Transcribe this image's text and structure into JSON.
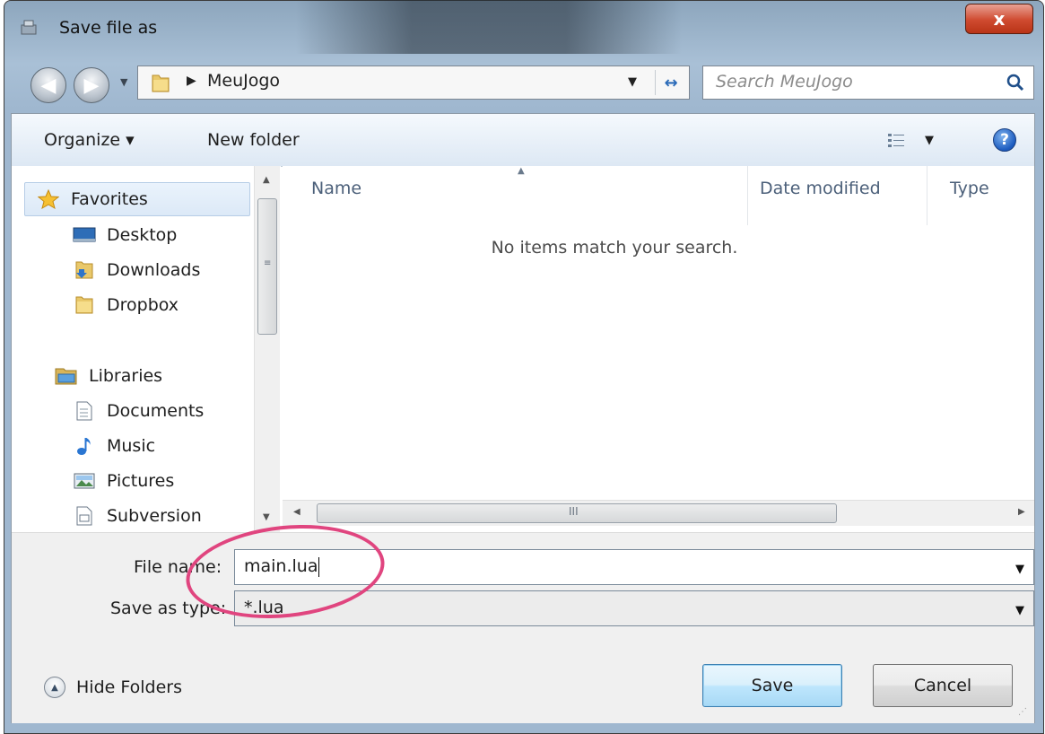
{
  "window": {
    "title": "Save file as",
    "close_label": "x"
  },
  "nav": {
    "back_icon": "back-arrow-icon",
    "forward_icon": "forward-arrow-icon",
    "breadcrumb": "MeuJogo",
    "search_placeholder": "Search MeuJogo"
  },
  "toolbar": {
    "organize": "Organize ▾",
    "new_folder": "New folder",
    "help": "?"
  },
  "sidebar": {
    "favorites_label": "Favorites",
    "favorites": [
      {
        "label": "Desktop",
        "icon": "desktop-icon"
      },
      {
        "label": "Downloads",
        "icon": "downloads-folder-icon"
      },
      {
        "label": "Dropbox",
        "icon": "folder-icon"
      }
    ],
    "libraries_label": "Libraries",
    "libraries": [
      {
        "label": "Documents",
        "icon": "documents-icon"
      },
      {
        "label": "Music",
        "icon": "music-icon"
      },
      {
        "label": "Pictures",
        "icon": "pictures-icon"
      },
      {
        "label": "Subversion",
        "icon": "subversion-icon"
      }
    ]
  },
  "file_list": {
    "columns": [
      "Name",
      "Date modified",
      "Type"
    ],
    "empty_message": "No items match your search.",
    "scroll_grip": "III"
  },
  "form": {
    "file_name_label": "File name:",
    "file_name_value": "main.lua",
    "save_type_label": "Save as type:",
    "save_type_value": "*.lua"
  },
  "footer": {
    "hide_folders": "Hide Folders",
    "save": "Save",
    "cancel": "Cancel"
  },
  "colors": {
    "annotation": "#e0457f",
    "save_button": "#bee6fd"
  }
}
